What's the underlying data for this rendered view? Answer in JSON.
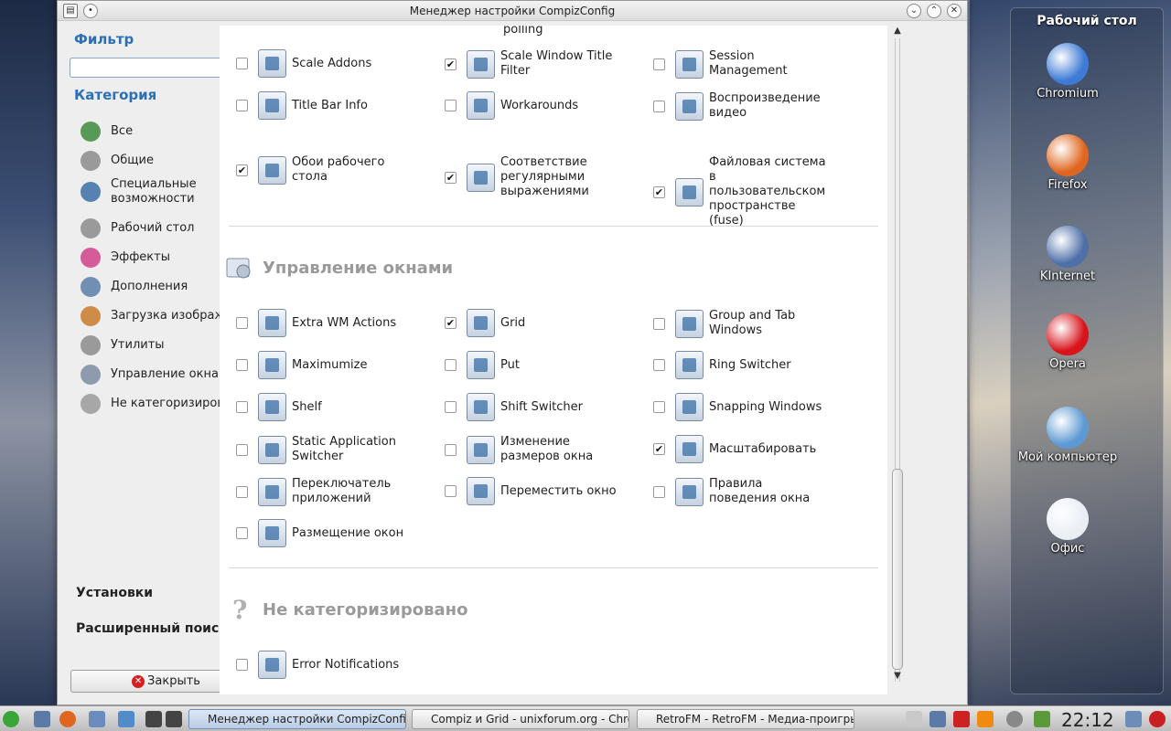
{
  "window": {
    "title": "Менеджер настройки CompizConfig",
    "buttons": [
      "v",
      "^",
      "x"
    ]
  },
  "sidebar": {
    "filter_heading": "Фильтр",
    "filter_value": "",
    "category_heading": "Категория",
    "categories": [
      {
        "label": "Все",
        "icon": "globe-icon"
      },
      {
        "label": "Общие",
        "icon": "gear-icon"
      },
      {
        "label": "Специальные возможности",
        "icon": "accessibility-icon"
      },
      {
        "label": "Рабочий стол",
        "icon": "desktop-gear-icon"
      },
      {
        "label": "Эффекты",
        "icon": "effects-icon"
      },
      {
        "label": "Дополнения",
        "icon": "extras-icon"
      },
      {
        "label": "Загрузка изображения",
        "icon": "image-loading-icon"
      },
      {
        "label": "Утилиты",
        "icon": "utilities-gear-icon"
      },
      {
        "label": "Управление окнами",
        "icon": "window-management-icon"
      },
      {
        "label": "Не категоризировано",
        "icon": "question-icon"
      }
    ],
    "settings_label": "Установки",
    "advanced_search_label": "Расширенный поиск",
    "close_label": "Закрыть"
  },
  "content": {
    "top_partial": [
      "",
      "polling",
      ""
    ],
    "top_plugins": [
      {
        "label": "Scale Addons",
        "checked": false
      },
      {
        "label": "Scale Window Title Filter",
        "checked": true
      },
      {
        "label": "Session Management",
        "checked": false
      },
      {
        "label": "Title Bar Info",
        "checked": false
      },
      {
        "label": "Workarounds",
        "checked": false
      },
      {
        "label": "Воспроизведение видео",
        "checked": false
      },
      {
        "label": "Обои рабочего стола",
        "checked": true
      },
      {
        "label": "Соответствие регулярными выражениями",
        "checked": true
      },
      {
        "label": "Файловая система в пользовательском пространстве (fuse)",
        "checked": true
      }
    ],
    "window_management_title": "Управление окнами",
    "wm_plugins": [
      {
        "label": "Extra WM Actions",
        "checked": false
      },
      {
        "label": "Grid",
        "checked": true
      },
      {
        "label": "Group and Tab Windows",
        "checked": false
      },
      {
        "label": "Maximumize",
        "checked": false
      },
      {
        "label": "Put",
        "checked": false
      },
      {
        "label": "Ring Switcher",
        "checked": false
      },
      {
        "label": "Shelf",
        "checked": false
      },
      {
        "label": "Shift Switcher",
        "checked": false
      },
      {
        "label": "Snapping Windows",
        "checked": false
      },
      {
        "label": "Static Application Switcher",
        "checked": false
      },
      {
        "label": "Изменение размеров окна",
        "checked": false
      },
      {
        "label": "Масштабировать",
        "checked": true
      },
      {
        "label": "Переключатель приложений",
        "checked": false
      },
      {
        "label": "Переместить окно",
        "checked": false
      },
      {
        "label": "Правила поведения окна",
        "checked": false
      },
      {
        "label": "Размещение окон",
        "checked": false
      }
    ],
    "uncategorized_title": "Не категоризировано",
    "uncat_plugins": [
      {
        "label": "Error Notifications",
        "checked": false
      }
    ]
  },
  "desktop": {
    "panel_title": "Рабочий стол",
    "icons": [
      {
        "label": "Chromium",
        "icon": "chromium-icon",
        "color": "#3d7bd6"
      },
      {
        "label": "Firefox",
        "icon": "firefox-icon",
        "color": "#e0661f"
      },
      {
        "label": "KInternet",
        "icon": "kinternet-icon",
        "color": "#4e6fa8"
      },
      {
        "label": "Opera",
        "icon": "opera-icon",
        "color": "#d8141b"
      },
      {
        "label": "Мой компьютер",
        "icon": "my-computer-icon",
        "color": "#5d9ad3"
      },
      {
        "label": "Офис",
        "icon": "office-icon",
        "color": "#e9eef5"
      }
    ]
  },
  "taskbar": {
    "tasks": [
      {
        "label": "Менеджер настройки CompizConfig",
        "active": true
      },
      {
        "label": "Compiz и Grid - unixforum.org - Chromium",
        "active": false
      },
      {
        "label": "RetroFM - RetroFM - Медиа-проигрыватель",
        "active": false
      }
    ],
    "clock": "22:12"
  }
}
